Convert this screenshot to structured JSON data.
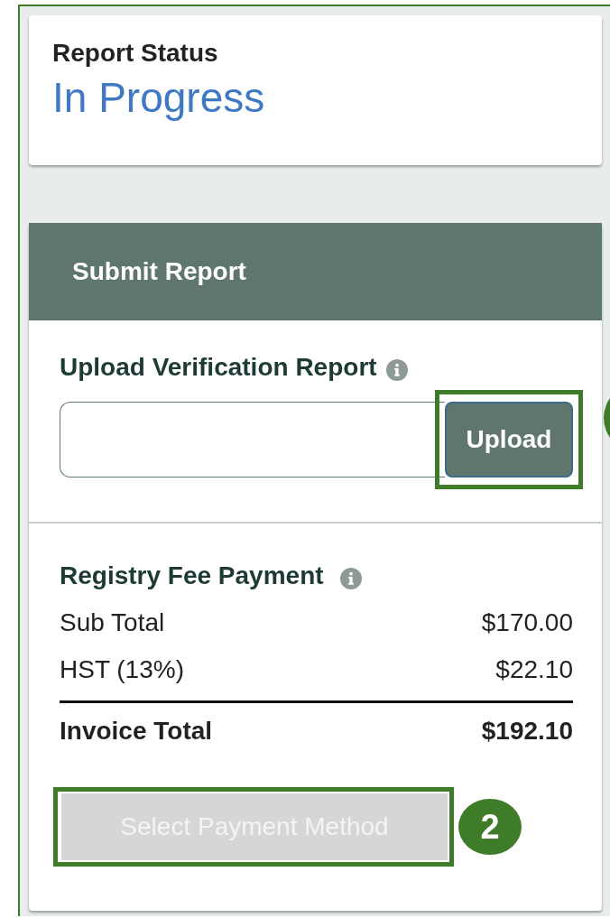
{
  "report_status": {
    "label": "Report Status",
    "value": "In Progress"
  },
  "submit_panel": {
    "title": "Submit Report",
    "upload": {
      "label": "Upload Verification Report",
      "button": {
        "label": "Upload",
        "disabled": false,
        "highlighted": true
      },
      "callout_cut": true
    },
    "fee": {
      "label": "Registry Fee Payment",
      "rows": [
        {
          "kind": "line",
          "name": "Sub Total",
          "amount": "$170.00"
        },
        {
          "kind": "line",
          "name": "HST (13%)",
          "amount": "$22.10"
        },
        {
          "kind": "total",
          "name": "Invoice Total",
          "amount": "$192.10"
        }
      ],
      "button": {
        "label": "Select Payment Method",
        "disabled": true,
        "highlighted": true
      },
      "callout": "2"
    }
  }
}
